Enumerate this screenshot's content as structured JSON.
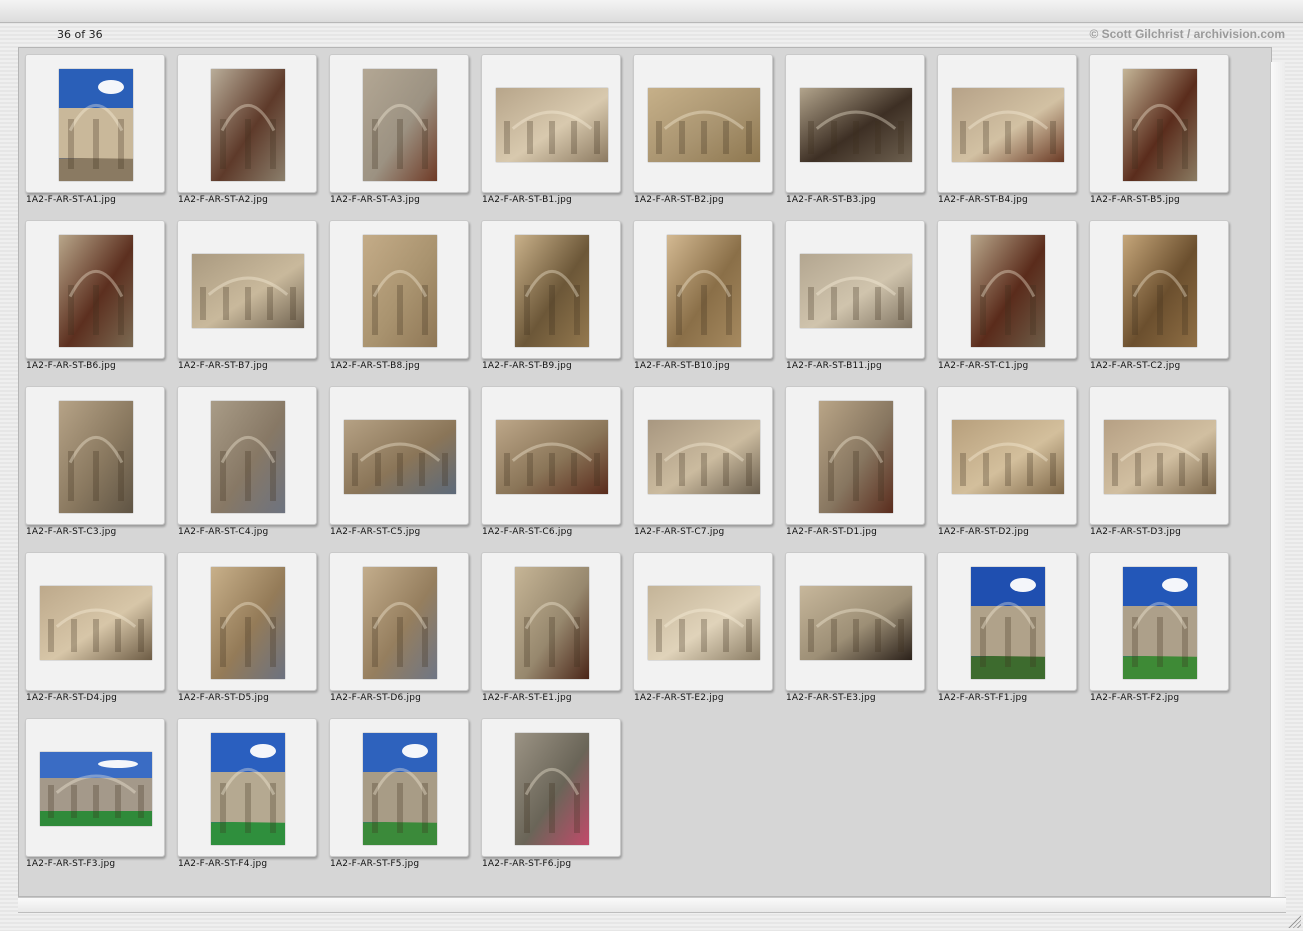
{
  "header": {
    "counter": "36 of 36",
    "copyright": "© Scott Gilchrist / archivision.com"
  },
  "icons": {
    "scroll_vertical": "scrollbar-vertical",
    "scroll_horizontal": "scrollbar-horizontal",
    "resize": "resize-grip-icon"
  },
  "thumbnails": [
    {
      "file": "1A2-F-AR-ST-A1.jpg",
      "orientation": "portrait",
      "palette": [
        "#2a5fb8",
        "#c9b89a",
        "#8a7a62"
      ],
      "sky": true
    },
    {
      "file": "1A2-F-AR-ST-A2.jpg",
      "orientation": "portrait",
      "palette": [
        "#b9ad99",
        "#8b7f6c",
        "#5e3a2a"
      ],
      "sky": false
    },
    {
      "file": "1A2-F-AR-ST-A3.jpg",
      "orientation": "portrait",
      "palette": [
        "#b3a794",
        "#6f3a26",
        "#9c9282"
      ],
      "sky": false
    },
    {
      "file": "1A2-F-AR-ST-B1.jpg",
      "orientation": "landscape",
      "palette": [
        "#b7a58a",
        "#8c7a61",
        "#d8c9ae"
      ],
      "sky": false
    },
    {
      "file": "1A2-F-AR-ST-B2.jpg",
      "orientation": "landscape",
      "palette": [
        "#c6b089",
        "#8e774f",
        "#a99470"
      ],
      "sky": false
    },
    {
      "file": "1A2-F-AR-ST-B3.jpg",
      "orientation": "landscape",
      "palette": [
        "#b2a48c",
        "#6e6150",
        "#3d2f24"
      ],
      "sky": false
    },
    {
      "file": "1A2-F-AR-ST-B4.jpg",
      "orientation": "landscape",
      "palette": [
        "#b6a288",
        "#6a3a25",
        "#d2c1a3"
      ],
      "sky": false
    },
    {
      "file": "1A2-F-AR-ST-B5.jpg",
      "orientation": "portrait",
      "palette": [
        "#c4b597",
        "#8a7b62",
        "#5a2c1c"
      ],
      "sky": false
    },
    {
      "file": "1A2-F-AR-ST-B6.jpg",
      "orientation": "portrait",
      "palette": [
        "#b8a68a",
        "#7b6a52",
        "#5c2f1f"
      ],
      "sky": false
    },
    {
      "file": "1A2-F-AR-ST-B7.jpg",
      "orientation": "landscape",
      "palette": [
        "#aa9a80",
        "#6f6250",
        "#c9b99c"
      ],
      "sky": false
    },
    {
      "file": "1A2-F-AR-ST-B8.jpg",
      "orientation": "portrait",
      "palette": [
        "#c4ac88",
        "#8f7756",
        "#a9936f"
      ],
      "sky": false
    },
    {
      "file": "1A2-F-AR-ST-B9.jpg",
      "orientation": "portrait",
      "palette": [
        "#c9b18a",
        "#94794f",
        "#6c5738"
      ],
      "sky": false
    },
    {
      "file": "1A2-F-AR-ST-B10.jpg",
      "orientation": "portrait",
      "palette": [
        "#d3b992",
        "#a68a60",
        "#8a6f48"
      ],
      "sky": false
    },
    {
      "file": "1A2-F-AR-ST-B11.jpg",
      "orientation": "landscape",
      "palette": [
        "#b3a690",
        "#7f7361",
        "#d0c4ad"
      ],
      "sky": false
    },
    {
      "file": "1A2-F-AR-ST-C1.jpg",
      "orientation": "portrait",
      "palette": [
        "#b9a78b",
        "#6d5d48",
        "#5a2b1b"
      ],
      "sky": false
    },
    {
      "file": "1A2-F-AR-ST-C2.jpg",
      "orientation": "portrait",
      "palette": [
        "#c5a67a",
        "#8f6f45",
        "#6b4f2e"
      ],
      "sky": false
    },
    {
      "file": "1A2-F-AR-ST-C3.jpg",
      "orientation": "portrait",
      "palette": [
        "#b6a387",
        "#5f5444",
        "#8a7960"
      ],
      "sky": false
    },
    {
      "file": "1A2-F-AR-ST-C4.jpg",
      "orientation": "portrait",
      "palette": [
        "#a99c87",
        "#6d7380",
        "#877865"
      ],
      "sky": false
    },
    {
      "file": "1A2-F-AR-ST-C5.jpg",
      "orientation": "landscape",
      "palette": [
        "#b5a184",
        "#5d6a7a",
        "#8a7558"
      ],
      "sky": false
    },
    {
      "file": "1A2-F-AR-ST-C6.jpg",
      "orientation": "landscape",
      "palette": [
        "#bda789",
        "#5a2b1c",
        "#8a7558"
      ],
      "sky": false
    },
    {
      "file": "1A2-F-AR-ST-C7.jpg",
      "orientation": "landscape",
      "palette": [
        "#a89780",
        "#6a5e4d",
        "#cbbb9f"
      ],
      "sky": false
    },
    {
      "file": "1A2-F-AR-ST-D1.jpg",
      "orientation": "portrait",
      "palette": [
        "#b9a587",
        "#5a2c1d",
        "#877660"
      ],
      "sky": false
    },
    {
      "file": "1A2-F-AR-ST-D2.jpg",
      "orientation": "landscape",
      "palette": [
        "#b79f7c",
        "#7d6647",
        "#d3bf9c"
      ],
      "sky": false
    },
    {
      "file": "1A2-F-AR-ST-D3.jpg",
      "orientation": "landscape",
      "palette": [
        "#b6a084",
        "#7a6549",
        "#d1bfa1"
      ],
      "sky": false
    },
    {
      "file": "1A2-F-AR-ST-D4.jpg",
      "orientation": "landscape",
      "palette": [
        "#bda98b",
        "#6d5c45",
        "#d7c6a8"
      ],
      "sky": false
    },
    {
      "file": "1A2-F-AR-ST-D5.jpg",
      "orientation": "portrait",
      "palette": [
        "#c8b08a",
        "#6c7280",
        "#947b58"
      ],
      "sky": false
    },
    {
      "file": "1A2-F-AR-ST-D6.jpg",
      "orientation": "portrait",
      "palette": [
        "#c3ad8c",
        "#6f7685",
        "#957e5e"
      ],
      "sky": false
    },
    {
      "file": "1A2-F-AR-ST-E1.jpg",
      "orientation": "portrait",
      "palette": [
        "#c6b596",
        "#4a2518",
        "#97886e"
      ],
      "sky": false
    },
    {
      "file": "1A2-F-AR-ST-E2.jpg",
      "orientation": "landscape",
      "palette": [
        "#c4b498",
        "#8a7c64",
        "#e0d3ba"
      ],
      "sky": false
    },
    {
      "file": "1A2-F-AR-ST-E3.jpg",
      "orientation": "landscape",
      "palette": [
        "#c7b79b",
        "#2b211a",
        "#9d8f76"
      ],
      "sky": false
    },
    {
      "file": "1A2-F-AR-ST-F1.jpg",
      "orientation": "portrait",
      "palette": [
        "#1f4fb0",
        "#b0a28a",
        "#3d6b2e"
      ],
      "sky": true
    },
    {
      "file": "1A2-F-AR-ST-F2.jpg",
      "orientation": "portrait",
      "palette": [
        "#2357b8",
        "#ada08a",
        "#3e8a36"
      ],
      "sky": true
    },
    {
      "file": "1A2-F-AR-ST-F3.jpg",
      "orientation": "landscape",
      "palette": [
        "#3a6cc4",
        "#a4998a",
        "#2f8a3a"
      ],
      "sky": true
    },
    {
      "file": "1A2-F-AR-ST-F4.jpg",
      "orientation": "portrait",
      "palette": [
        "#2a5fbf",
        "#b5a991",
        "#2f8f3d"
      ],
      "sky": true
    },
    {
      "file": "1A2-F-AR-ST-F5.jpg",
      "orientation": "portrait",
      "palette": [
        "#2e62bd",
        "#a89c86",
        "#3b8a3a"
      ],
      "sky": true
    },
    {
      "file": "1A2-F-AR-ST-F6.jpg",
      "orientation": "portrait",
      "palette": [
        "#9b9384",
        "#c24a6a",
        "#6a6558"
      ],
      "sky": false
    }
  ]
}
